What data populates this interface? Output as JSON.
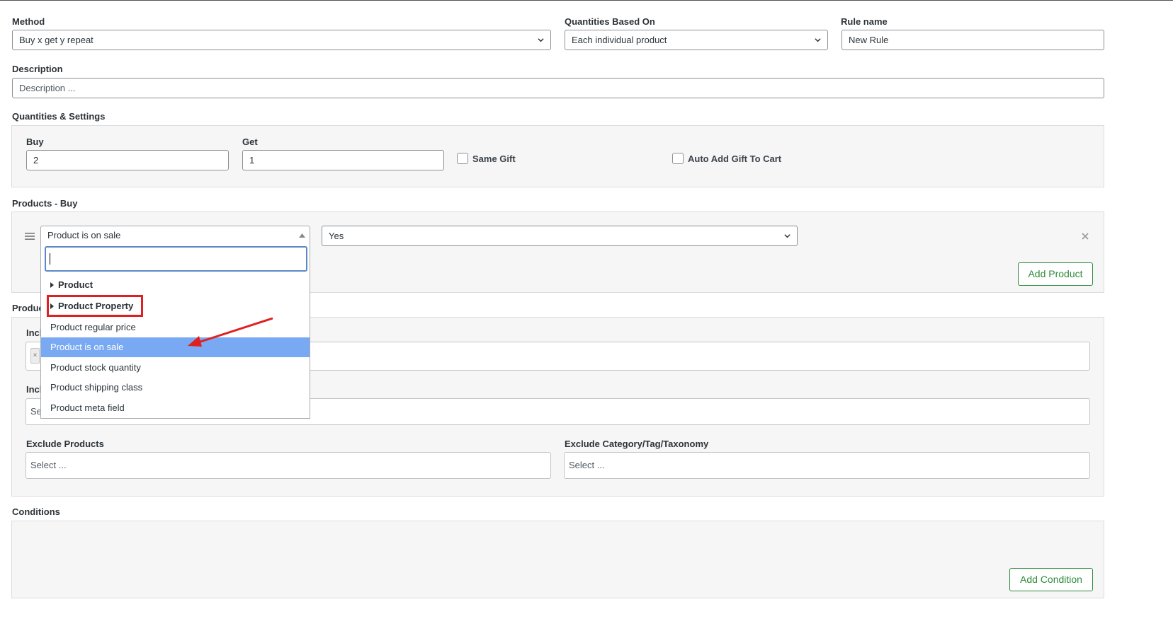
{
  "rule": {
    "method": {
      "label": "Method",
      "value": "Buy x get y repeat"
    },
    "quantities_based_on": {
      "label": "Quantities Based On",
      "value": "Each individual product"
    },
    "rule_name": {
      "label": "Rule name",
      "value": "New Rule"
    },
    "description": {
      "label": "Description",
      "placeholder": "Description ..."
    }
  },
  "quantities": {
    "section_label": "Quantities & Settings",
    "buy": {
      "label": "Buy",
      "value": "2"
    },
    "get": {
      "label": "Get",
      "value": "1"
    },
    "same_gift": {
      "label": "Same Gift",
      "checked": false
    },
    "auto_add_gift": {
      "label": "Auto Add Gift To Cart",
      "checked": false
    }
  },
  "products_buy": {
    "section_label": "Products - Buy",
    "filter_select": {
      "value": "Product is on sale"
    },
    "yes_select": {
      "value": "Yes"
    },
    "add_product_label": "Add Product",
    "remove_icon": "close-icon",
    "drag_icon": "drag-handle-icon"
  },
  "dropdown": {
    "search_value": "",
    "groups": [
      {
        "label": "Product"
      },
      {
        "label": "Product Property"
      }
    ],
    "options": [
      {
        "label": "Product regular price",
        "highlighted": false
      },
      {
        "label": "Product is on sale",
        "highlighted": true
      },
      {
        "label": "Product stock quantity",
        "highlighted": false
      },
      {
        "label": "Product shipping class",
        "highlighted": false
      },
      {
        "label": "Product meta field",
        "highlighted": false
      }
    ]
  },
  "products_get": {
    "section_label_visible": "Produc",
    "include1_label_visible": "Incl",
    "include2_label_visible": "Incl",
    "include2_placeholder_visible": "Se",
    "tag_remove_glyph": "×",
    "exclude_products": {
      "label": "Exclude Products",
      "placeholder": "Select ..."
    },
    "exclude_taxonomy": {
      "label": "Exclude Category/Tag/Taxonomy",
      "placeholder": "Select ..."
    }
  },
  "conditions": {
    "section_label": "Conditions",
    "add_condition_label": "Add Condition"
  },
  "colors": {
    "green_button": "#2e8b3a",
    "highlight": "#79a9f2",
    "annotation_red": "#e02020",
    "panel_bg": "#f6f6f6"
  }
}
